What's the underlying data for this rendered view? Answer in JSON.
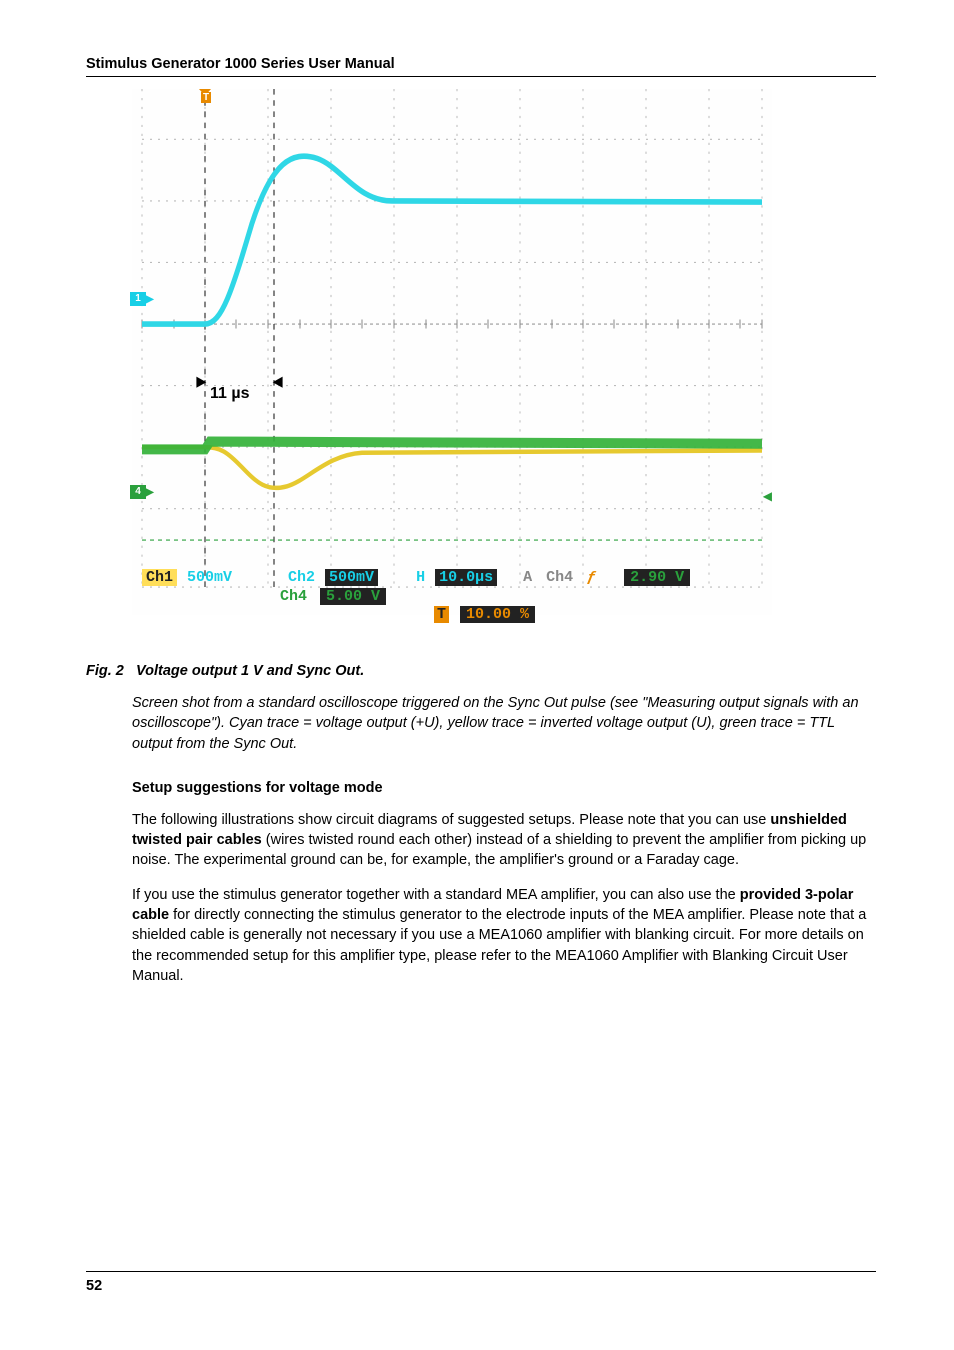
{
  "header": {
    "title": "Stimulus Generator 1000 Series User Manual"
  },
  "scope": {
    "trigger_top": "T",
    "ch1_marker": "1",
    "ch4_marker": "4",
    "annot_11us": "11 µs",
    "readout": {
      "ch1_label": "Ch1",
      "ch1_value": "500mV",
      "ch2_label": "Ch2",
      "ch2_value": "500mV",
      "h_label": "H",
      "h_value": "10.0µs",
      "a_label": "A",
      "ch4_label": "Ch4",
      "slope": "ƒ",
      "trig_value": "2.90 V",
      "ch4_row2_label": "Ch4",
      "ch4_row2_value": "5.00 V",
      "t_label": "T",
      "t_value": "10.00 %"
    }
  },
  "figure": {
    "caption_label": "Fig. 2",
    "caption_text": "Voltage output 1 V and Sync Out.",
    "description": "Screen shot from a standard oscilloscope triggered on the Sync Out pulse (see \"Measuring output signals with an oscilloscope\"). Cyan trace = voltage output (+U), yellow trace = inverted voltage output (U), green trace = TTL output from the Sync Out."
  },
  "section": {
    "heading": "Setup suggestions for voltage mode"
  },
  "para1": {
    "t1": "The following illustrations show circuit diagrams of suggested setups. Please note that you can use ",
    "b1": "unshielded twisted pair cables",
    "t2": " (wires twisted round each other) instead of a shielding to prevent the amplifier from picking up noise. The experimental ground can be, for example, the amplifier's ground or a Faraday cage."
  },
  "para2": {
    "t1": "If you use the stimulus generator together with a standard MEA amplifier, you can also use the ",
    "b1": "provided 3-polar cable",
    "t2": " for directly connecting the stimulus generator to the electrode inputs of the MEA amplifier. Please note that a shielded cable is generally not necessary if you use a MEA1060 amplifier with blanking circuit. For more details on the recommended setup for this amplifier type, please refer to the MEA1060 Amplifier with Blanking Circuit User Manual."
  },
  "footer": {
    "page": "52"
  }
}
